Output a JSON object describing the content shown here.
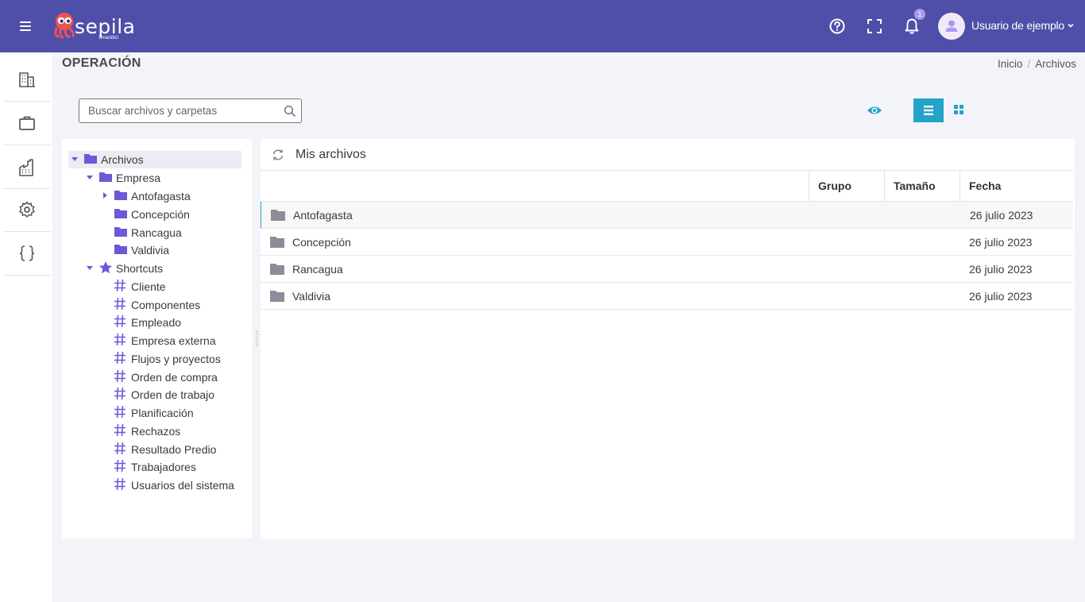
{
  "app": {
    "logo_text": "sepila",
    "logo_sub": "Smartdici"
  },
  "topbar": {
    "notification_count": "1",
    "user_name": "Usuario de ejemplo",
    "user_chevron": "▾",
    "icons": [
      "menu-icon",
      "help-icon",
      "fullscreen-icon",
      "bell-icon",
      "user-icon"
    ]
  },
  "sidenav": {
    "items": [
      "building-icon",
      "briefcase-icon",
      "factory-icon",
      "settings-icon",
      "braces-icon"
    ]
  },
  "page": {
    "title": "OPERACIÓN",
    "breadcrumb": {
      "home": "Inicio",
      "separator": "/",
      "current": "Archivos"
    }
  },
  "search": {
    "placeholder": "Buscar archivos y carpetas",
    "value": ""
  },
  "tree": {
    "root": "Archivos",
    "empresa": "Empresa",
    "empresa_children": [
      "Antofagasta",
      "Concepción",
      "Rancagua",
      "Valdivia"
    ],
    "shortcuts": "Shortcuts",
    "shortcut_items": [
      "Cliente",
      "Componentes",
      "Empleado",
      "Empresa externa",
      "Flujos y proyectos",
      "Orden de compra",
      "Orden de trabajo",
      "Planificación",
      "Rechazos",
      "Resultado Predio",
      "Trabajadores",
      "Usuarios del sistema"
    ]
  },
  "files": {
    "title": "Mis archivos",
    "columns": {
      "name": "",
      "group": "Grupo",
      "size": "Tamaño",
      "date": "Fecha"
    },
    "rows": [
      {
        "name": "Antofagasta",
        "group": "",
        "size": "",
        "date": "26 julio 2023"
      },
      {
        "name": "Concepción",
        "group": "",
        "size": "",
        "date": "26 julio 2023"
      },
      {
        "name": "Rancagua",
        "group": "",
        "size": "",
        "date": "26 julio 2023"
      },
      {
        "name": "Valdivia",
        "group": "",
        "size": "",
        "date": "26 julio 2023"
      }
    ]
  },
  "colors": {
    "topbar": "#4f4fa9",
    "accent": "#23a3c5",
    "tree_folder": "#6a5ad8",
    "table_folder": "#8c8c9a",
    "badge": "#a69bf0",
    "background": "#f3f3fa"
  }
}
